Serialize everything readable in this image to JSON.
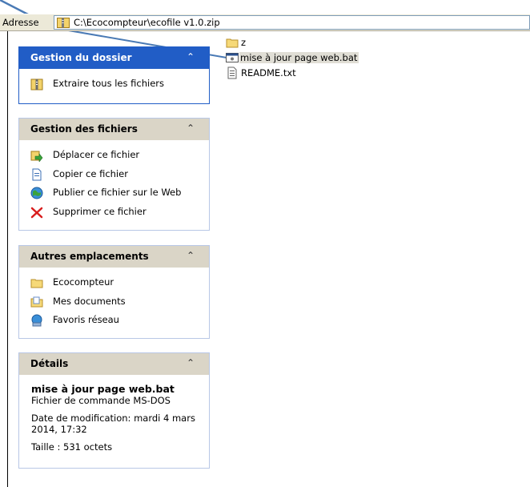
{
  "address": {
    "label": "Adresse",
    "path": "C:\\Ecocompteur\\ecofile v1.0.zip"
  },
  "panels": {
    "folder_tasks": {
      "title": "Gestion du dossier",
      "items": [
        {
          "label": "Extraire tous les fichiers",
          "icon": "zip-folder-icon"
        }
      ]
    },
    "file_tasks": {
      "title": "Gestion des fichiers",
      "items": [
        {
          "label": "Déplacer ce fichier",
          "icon": "move-file-icon"
        },
        {
          "label": "Copier ce fichier",
          "icon": "copy-file-icon"
        },
        {
          "label": "Publier ce fichier sur le Web",
          "icon": "globe-icon"
        },
        {
          "label": "Supprimer ce fichier",
          "icon": "delete-x-icon"
        }
      ]
    },
    "other_places": {
      "title": "Autres emplacements",
      "items": [
        {
          "label": "Ecocompteur",
          "icon": "folder-icon"
        },
        {
          "label": "Mes documents",
          "icon": "my-documents-icon"
        },
        {
          "label": "Favoris réseau",
          "icon": "network-places-icon"
        }
      ]
    },
    "details": {
      "title": "Détails",
      "name": "mise à jour page web.bat",
      "type": "Fichier de commande MS-DOS",
      "modified": "Date de modification: mardi 4 mars 2014, 17:32",
      "size": "Taille : 531 octets"
    }
  },
  "files": [
    {
      "name": "z",
      "icon": "folder-icon",
      "selected": false
    },
    {
      "name": "mise à jour page web.bat",
      "icon": "batch-file-icon",
      "selected": true
    },
    {
      "name": "README.txt",
      "icon": "text-file-icon",
      "selected": false
    }
  ],
  "colors": {
    "pane_header_dark": "#215dc6",
    "pane_header_light": "#dad5c7",
    "connector_line": "#4a7ab5",
    "selection": "#e0ded5"
  }
}
